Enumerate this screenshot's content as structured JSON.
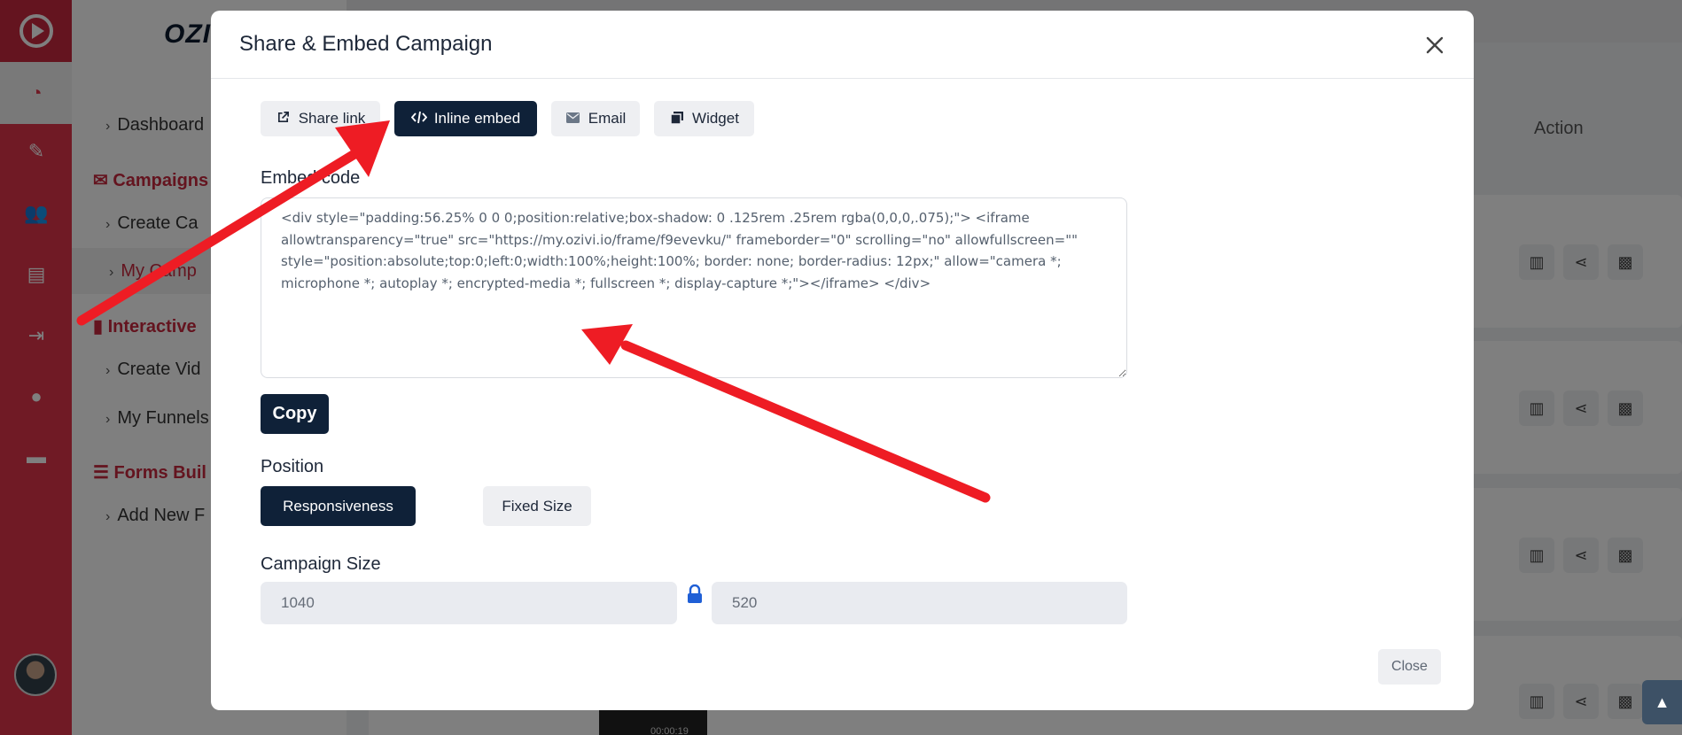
{
  "background": {
    "brand": "OZI",
    "sidebar": {
      "items": [
        {
          "label": "Dashboard",
          "type": "item"
        },
        {
          "label": "Campaigns",
          "type": "section"
        },
        {
          "label": "Create Ca",
          "type": "item"
        },
        {
          "label": "My Camp",
          "type": "item"
        },
        {
          "label": "Interactive",
          "type": "section"
        },
        {
          "label": "Create Vid",
          "type": "item"
        },
        {
          "label": "My Funnels",
          "type": "item"
        },
        {
          "label": "Forms Buil",
          "type": "section"
        },
        {
          "label": "Add New F",
          "type": "item"
        }
      ]
    },
    "table": {
      "action_header": "Action"
    },
    "thumbnail_time": "00:00:19"
  },
  "modal": {
    "title": "Share & Embed Campaign",
    "close_icon": "close-icon",
    "tabs": [
      {
        "label": "Share link",
        "icon": "external-link-icon"
      },
      {
        "label": "Inline embed",
        "icon": "code-icon",
        "active": true
      },
      {
        "label": "Email",
        "icon": "envelope-icon"
      },
      {
        "label": "Widget",
        "icon": "widget-icon"
      }
    ],
    "embed": {
      "label": "Embed code",
      "code": "<div style=\"padding:56.25% 0 0 0;position:relative;box-shadow: 0 .125rem .25rem rgba(0,0,0,.075);\"> <iframe allowtransparency=\"true\" src=\"https://my.ozivi.io/frame/f9evevku/\" frameborder=\"0\" scrolling=\"no\" allowfullscreen=\"\" style=\"position:absolute;top:0;left:0;width:100%;height:100%; border: none; border-radius: 12px;\" allow=\"camera *; microphone *; autoplay *; encrypted-media *; fullscreen *; display-capture *;\"></iframe> </div>",
      "copy_label": "Copy"
    },
    "position": {
      "label": "Position",
      "options": [
        "Responsiveness",
        "Fixed Size"
      ],
      "selected": "Responsiveness"
    },
    "campaign_size": {
      "label": "Campaign Size",
      "width": "1040",
      "height": "520",
      "lock_icon": "lock-icon"
    },
    "footer": {
      "close_label": "Close"
    }
  },
  "colors": {
    "primary_dark": "#0f2138",
    "brand_red": "#e0344b",
    "annotation_red": "#ee1c24"
  }
}
